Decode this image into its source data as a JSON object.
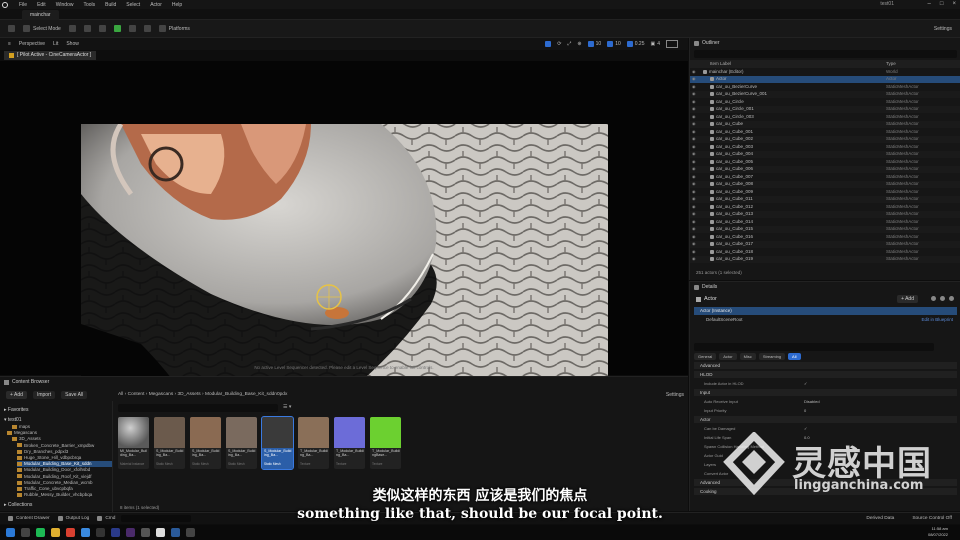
{
  "menubar": {
    "items": [
      "File",
      "Edit",
      "Window",
      "Tools",
      "Build",
      "Select",
      "Actor",
      "Help"
    ],
    "project": "test01"
  },
  "tab": {
    "label": "mainchar"
  },
  "toolbar": {
    "select_mode": "Select Mode",
    "platforms": "Platforms",
    "settings": "Settings"
  },
  "viewport": {
    "perspective": "Perspective",
    "lit": "Lit",
    "show": "Show",
    "pilot_label": "[ Pilot Active - CineCameraActor ]",
    "snap_angle": "10",
    "snap_grid": "10",
    "scale": "0.25",
    "camera_speed": "4",
    "note": "No active Level Sequencer detected. Please edit a Level Sequence to enable full controls."
  },
  "outliner": {
    "tab": "Outliner",
    "col_label": "Item Label",
    "col_type": "Type",
    "rows": [
      {
        "name": "mainchar (Editor)",
        "type": "World",
        "indent": 1
      },
      {
        "name": "Actor",
        "type": "Actor",
        "indent": 2,
        "selected": true
      },
      {
        "name": "car_ou_BezierCurve",
        "type": "StaticMeshActor",
        "indent": 2
      },
      {
        "name": "car_ou_BezierCurve_001",
        "type": "StaticMeshActor",
        "indent": 2
      },
      {
        "name": "car_ou_Circle",
        "type": "StaticMeshActor",
        "indent": 2
      },
      {
        "name": "car_ou_Circle_001",
        "type": "StaticMeshActor",
        "indent": 2
      },
      {
        "name": "car_ou_Circle_003",
        "type": "StaticMeshActor",
        "indent": 2
      },
      {
        "name": "car_ou_Cube",
        "type": "StaticMeshActor",
        "indent": 2
      },
      {
        "name": "car_ou_Cube_001",
        "type": "StaticMeshActor",
        "indent": 2
      },
      {
        "name": "car_ou_Cube_002",
        "type": "StaticMeshActor",
        "indent": 2
      },
      {
        "name": "car_ou_Cube_003",
        "type": "StaticMeshActor",
        "indent": 2
      },
      {
        "name": "car_ou_Cube_004",
        "type": "StaticMeshActor",
        "indent": 2
      },
      {
        "name": "car_ou_Cube_005",
        "type": "StaticMeshActor",
        "indent": 2
      },
      {
        "name": "car_ou_Cube_006",
        "type": "StaticMeshActor",
        "indent": 2
      },
      {
        "name": "car_ou_Cube_007",
        "type": "StaticMeshActor",
        "indent": 2
      },
      {
        "name": "car_ou_Cube_008",
        "type": "StaticMeshActor",
        "indent": 2
      },
      {
        "name": "car_ou_Cube_009",
        "type": "StaticMeshActor",
        "indent": 2
      },
      {
        "name": "car_ou_Cube_011",
        "type": "StaticMeshActor",
        "indent": 2
      },
      {
        "name": "car_ou_Cube_012",
        "type": "StaticMeshActor",
        "indent": 2
      },
      {
        "name": "car_ou_Cube_013",
        "type": "StaticMeshActor",
        "indent": 2
      },
      {
        "name": "car_ou_Cube_014",
        "type": "StaticMeshActor",
        "indent": 2
      },
      {
        "name": "car_ou_Cube_015",
        "type": "StaticMeshActor",
        "indent": 2
      },
      {
        "name": "car_ou_Cube_016",
        "type": "StaticMeshActor",
        "indent": 2
      },
      {
        "name": "car_ou_Cube_017",
        "type": "StaticMeshActor",
        "indent": 2
      },
      {
        "name": "car_ou_Cube_018",
        "type": "StaticMeshActor",
        "indent": 2
      },
      {
        "name": "car_ou_Cube_019",
        "type": "StaticMeshActor",
        "indent": 2
      }
    ],
    "status": "251 actors (1 selected)"
  },
  "details": {
    "tab": "Details",
    "title": "Actor",
    "add_label": "+ Add",
    "component_selected": "Actor (Instance)",
    "component_child": "DefaultSceneRoot",
    "edit_blueprint": "Edit in Blueprint",
    "filters": [
      "General",
      "Actor",
      "Misc",
      "Streaming",
      "All"
    ],
    "active_filter": 4,
    "sections": [
      {
        "label": "Advanced",
        "props": []
      },
      {
        "label": "HLOD",
        "props": [
          {
            "name": "Include Actor in HLOD",
            "value": "✓"
          }
        ]
      },
      {
        "label": "Input",
        "props": [
          {
            "name": "Auto Receive Input",
            "value": "Disabled"
          },
          {
            "name": "Input Priority",
            "value": "0"
          }
        ]
      },
      {
        "label": "Actor",
        "props": [
          {
            "name": "Can be Damaged",
            "value": "✓"
          },
          {
            "name": "Initial Life Span",
            "value": "0.0"
          },
          {
            "name": "Spawn Collision Handling Method",
            "value": ""
          },
          {
            "name": "Actor Guid",
            "value": ""
          },
          {
            "name": "Layers",
            "value": ""
          },
          {
            "name": "Convert Actor",
            "value": ""
          }
        ]
      },
      {
        "label": "Advanced",
        "props": []
      },
      {
        "label": "Cooking",
        "props": []
      }
    ]
  },
  "content_browser": {
    "tab": "Content Browser",
    "add": "+ Add",
    "import": "Import",
    "save_all": "Save All",
    "path": [
      "All",
      "Content",
      "Megascans",
      "3D_Assets",
      "Modular_Building_Base_Kit_sddn0pdx"
    ],
    "settings": "Settings",
    "favorites": "Favorites",
    "project": "test01",
    "tree": [
      {
        "name": "maps",
        "indent": 2
      },
      {
        "name": "Megascans",
        "indent": 1
      },
      {
        "name": "3D_Assets",
        "indent": 2
      },
      {
        "name": "Broken_Concrete_Barrier_xmpdbw",
        "indent": 3
      },
      {
        "name": "Dry_Branches_pdpxl3",
        "indent": 3
      },
      {
        "name": "Huge_Stone_Hill_vdbpcbrqa",
        "indent": 3
      },
      {
        "name": "Modular_Building_Base_Kit_sddn",
        "indent": 3,
        "selected": true
      },
      {
        "name": "Modular_Building_Door_xfolhsbd",
        "indent": 3
      },
      {
        "name": "Modular_Building_Roof_Kit_viejdf",
        "indent": 3
      },
      {
        "name": "Modular_Concrete_Median_wcmb",
        "indent": 3
      },
      {
        "name": "Traffic_Cone_ubvcpbqfa",
        "indent": 3
      },
      {
        "name": "Rubble_Messy_Builder_vhcbpbqa",
        "indent": 3
      }
    ],
    "collections": "Collections",
    "assets": [
      {
        "label": "MI_Modular_Building_Ba...",
        "type": "Material Instance",
        "thumb": "#7e7e7e"
      },
      {
        "label": "S_Modular_Building_Ba...",
        "type": "Static Mesh",
        "thumb": "#6b5a4c"
      },
      {
        "label": "S_Modular_Building_Ba...",
        "type": "Static Mesh",
        "thumb": "#8a6a52"
      },
      {
        "label": "S_Modular_Building_Ba...",
        "type": "Static Mesh",
        "thumb": "#7a6a5e"
      },
      {
        "label": "S_Modular_Building_Ba...",
        "type": "Static Mesh",
        "thumb": "#3a3a3a",
        "selected": true
      },
      {
        "label": "T_Modular_Building_Ba...",
        "type": "Texture",
        "thumb": "#8a6f58"
      },
      {
        "label": "T_Modular_Building_Ba...",
        "type": "Texture",
        "thumb": "#6c6cd8"
      },
      {
        "label": "T_Modular_BuildingBase...",
        "type": "Texture",
        "thumb": "#6cd030"
      }
    ],
    "status": "8 items (1 selected)"
  },
  "statusbar": {
    "content_drawer": "Content Drawer",
    "output_log": "Output Log",
    "cmd": "Cmd",
    "derived_data": "Derived Data",
    "source_control": "Source Control Off"
  },
  "taskbar": {
    "time": "11:58 am",
    "date": "08/07/2022"
  },
  "subtitle": {
    "cn": "类似这样的东西 应该是我们的焦点",
    "en": "something like that, should be our focal point."
  },
  "watermark": {
    "cn": "灵感中国",
    "en": "lingganchina.com"
  }
}
